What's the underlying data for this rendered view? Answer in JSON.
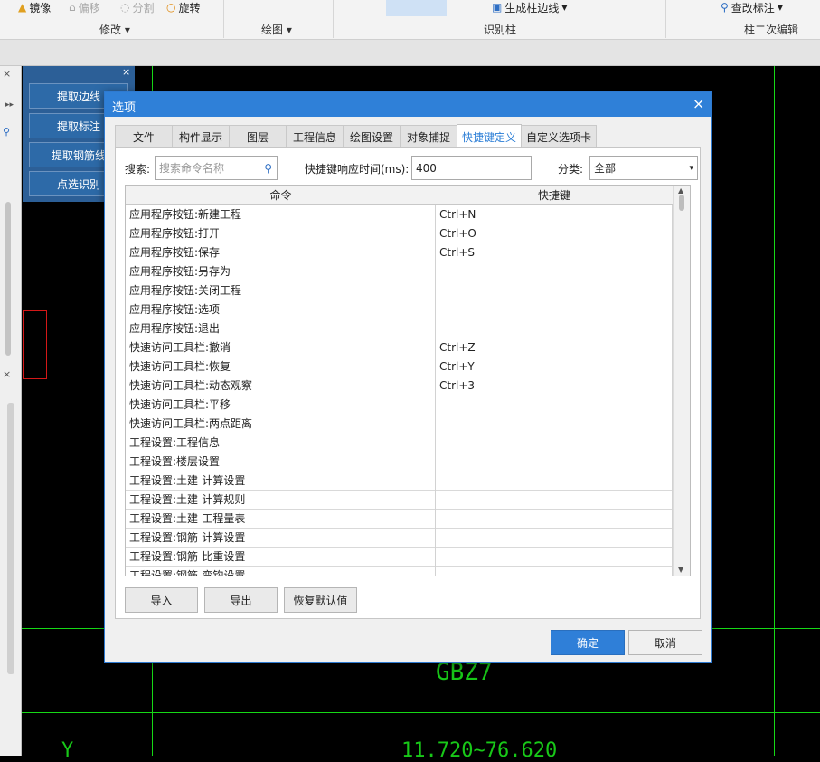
{
  "ribbon": {
    "mirror": "镜像",
    "offset": "偏移",
    "split": "分割",
    "rotate": "旋转",
    "group_modify": "修改",
    "group_draw": "绘图",
    "group_identify_column": "识别柱",
    "gen_column_edge": "生成柱边线",
    "check_annotation": "查改标注",
    "group_column_edit": "柱二次编辑"
  },
  "panel": {
    "buttons": [
      "提取边线",
      "提取标注",
      "提取钢筋线",
      "点选识别"
    ]
  },
  "canvas": {
    "label_gbz": "GBZ7",
    "label_coord": "11.720~76.620",
    "label_y": "Y"
  },
  "dialog": {
    "title": "选项",
    "close": "×",
    "tabs": [
      "文件",
      "构件显示",
      "图层",
      "工程信息",
      "绘图设置",
      "对象捕捉",
      "快捷键定义",
      "自定义选项卡"
    ],
    "active_tab": "快捷键定义",
    "search_label": "搜索:",
    "search_placeholder": "搜索命令名称",
    "time_label": "快捷键响应时间(ms):",
    "time_value": "400",
    "category_label": "分类:",
    "category_value": "全部",
    "columns": [
      "命令",
      "快捷键"
    ],
    "rows": [
      {
        "cmd": "应用程序按钮:新建工程",
        "key": "Ctrl+N"
      },
      {
        "cmd": "应用程序按钮:打开",
        "key": "Ctrl+O"
      },
      {
        "cmd": "应用程序按钮:保存",
        "key": "Ctrl+S"
      },
      {
        "cmd": "应用程序按钮:另存为",
        "key": ""
      },
      {
        "cmd": "应用程序按钮:关闭工程",
        "key": ""
      },
      {
        "cmd": "应用程序按钮:选项",
        "key": ""
      },
      {
        "cmd": "应用程序按钮:退出",
        "key": ""
      },
      {
        "cmd": "快速访问工具栏:撤消",
        "key": "Ctrl+Z"
      },
      {
        "cmd": "快速访问工具栏:恢复",
        "key": "Ctrl+Y"
      },
      {
        "cmd": "快速访问工具栏:动态观察",
        "key": "Ctrl+3"
      },
      {
        "cmd": "快速访问工具栏:平移",
        "key": ""
      },
      {
        "cmd": "快速访问工具栏:两点距离",
        "key": ""
      },
      {
        "cmd": "工程设置:工程信息",
        "key": ""
      },
      {
        "cmd": "工程设置:楼层设置",
        "key": ""
      },
      {
        "cmd": "工程设置:土建-计算设置",
        "key": ""
      },
      {
        "cmd": "工程设置:土建-计算规则",
        "key": ""
      },
      {
        "cmd": "工程设置:土建-工程量表",
        "key": ""
      },
      {
        "cmd": "工程设置:钢筋-计算设置",
        "key": ""
      },
      {
        "cmd": "工程设置:钢筋-比重设置",
        "key": ""
      },
      {
        "cmd": "工程设置:钢筋-弯钩设置",
        "key": ""
      }
    ],
    "btn_import": "导入",
    "btn_export": "导出",
    "btn_restore": "恢复默认值",
    "btn_ok": "确定",
    "btn_cancel": "取消"
  }
}
